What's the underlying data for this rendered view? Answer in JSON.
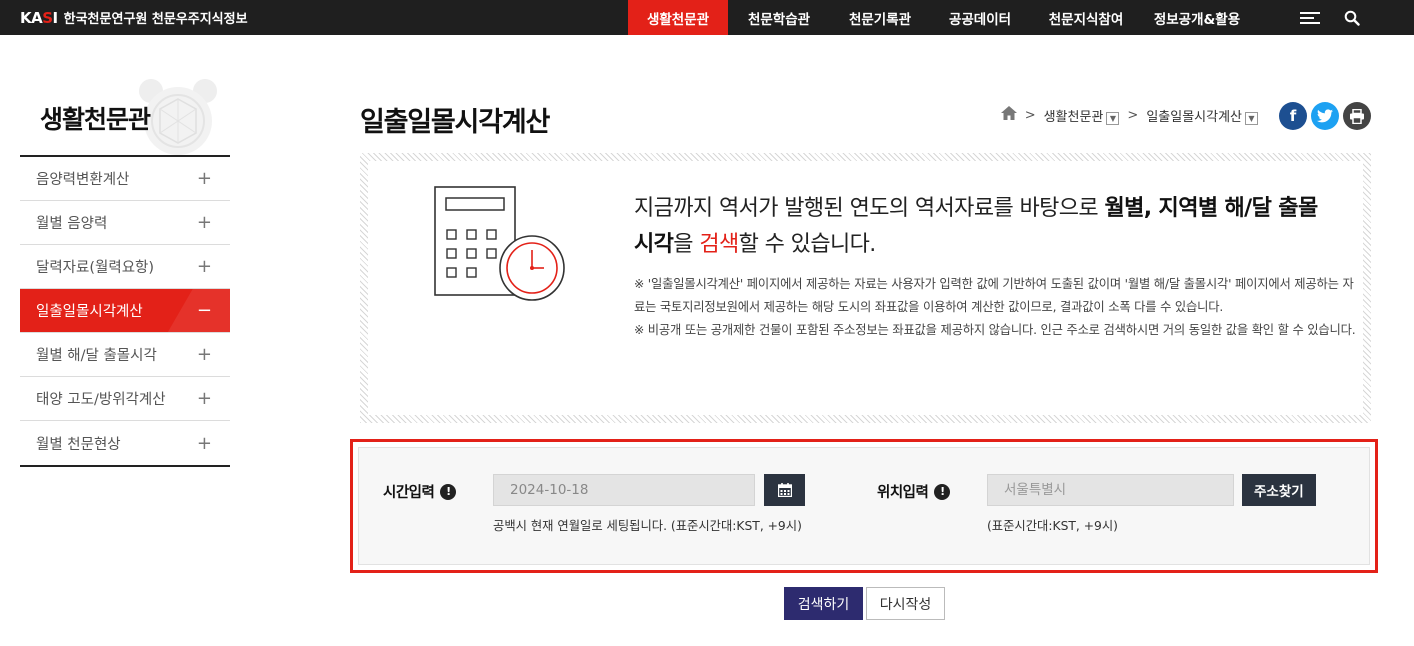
{
  "brand": {
    "logo_left": "KA",
    "logo_mark": "S",
    "logo_right": "I",
    "name": "한국천문연구원 천문우주지식정보"
  },
  "nav": {
    "items": [
      {
        "label": "생활천문관",
        "active": true
      },
      {
        "label": "천문학습관"
      },
      {
        "label": "천문기록관"
      },
      {
        "label": "공공데이터"
      },
      {
        "label": "천문지식참여"
      },
      {
        "label": "정보공개&활용"
      }
    ]
  },
  "sidebar": {
    "title": "생활천문관",
    "items": [
      {
        "label": "음양력변환계산",
        "toggle": "+"
      },
      {
        "label": "월별 음양력",
        "toggle": "+"
      },
      {
        "label": "달력자료(월력요항)",
        "toggle": "+"
      },
      {
        "label": "일출일몰시각계산",
        "toggle": "−",
        "active": true
      },
      {
        "label": "월별 해/달 출몰시각",
        "toggle": "+"
      },
      {
        "label": "태양 고도/방위각계산",
        "toggle": "+"
      },
      {
        "label": "월별 천문현상",
        "toggle": "+"
      }
    ]
  },
  "page": {
    "title": "일출일몰시각계산"
  },
  "breadcrumb": {
    "level1": "생활천문관",
    "level2": "일출일몰시각계산",
    "sep": ">"
  },
  "share": {
    "facebook": "f",
    "twitter": "t"
  },
  "info": {
    "lead_part1": "지금까지 역서가 발행된 연도의 역서자료를 바탕으로 ",
    "lead_bold": "월별, 지역별 해/달 출몰시각",
    "lead_part2": "을 ",
    "lead_red": "검색",
    "lead_part3": "할 수 있습니다.",
    "note1": "※ '일출일몰시각계산' 페이지에서 제공하는 자료는 사용자가 입력한 값에 기반하여 도출된 값이며 '월별 해/달 출몰시각' 페이지에서 제공하는 자료는 국토지리정보원에서 제공하는 해당 도시의 좌표값을 이용하여 계산한 값이므로, 결과값이 소폭 다를 수 있습니다.",
    "note2": "※ 비공개 또는 공개제한 건물이 포함된 주소정보는 좌표값을 제공하지 않습니다. 인근 주소로 검색하시면 거의 동일한 값을 확인 할 수 있습니다."
  },
  "form": {
    "time_label": "시간입력",
    "time_value": "2024-10-18",
    "time_help": "공백시 현재 연월일로 세팅됩니다. (표준시간대:KST, +9시)",
    "location_label": "위치입력",
    "location_placeholder": "서울특별시",
    "location_help": "(표준시간대:KST, +9시)",
    "address_button": "주소찾기",
    "info_mark": "!"
  },
  "actions": {
    "search": "검색하기",
    "reset": "다시작성"
  },
  "colors": {
    "accent": "#e32118",
    "topbar": "#1f1f1f",
    "button_dark": "#2b3340",
    "search_button": "#2d2b6f",
    "facebook": "#1d4f91",
    "twitter": "#1da1f2",
    "print": "#444444"
  }
}
